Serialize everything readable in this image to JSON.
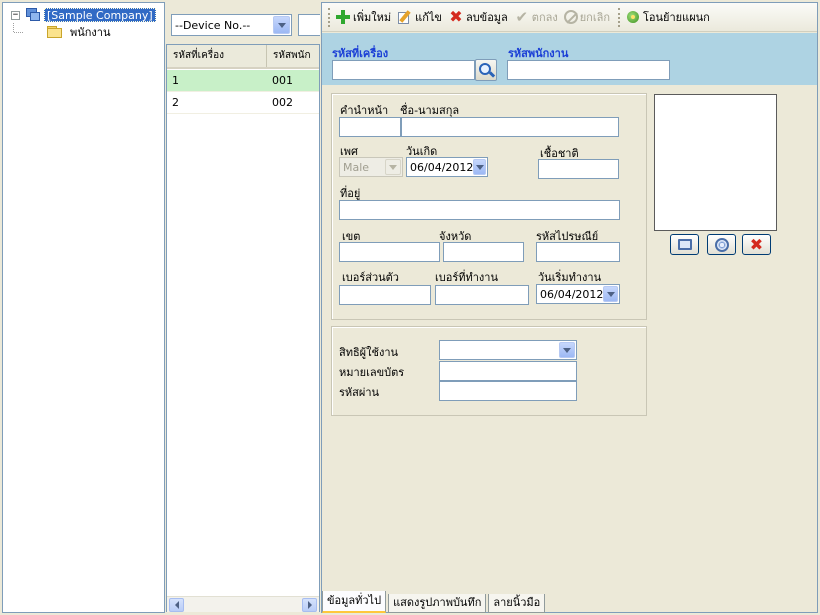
{
  "tree": {
    "root_label": "[Sample Company]",
    "child_label": "พนักงาน",
    "root_expander": "−"
  },
  "device_filter": {
    "value": "--Device No.--"
  },
  "grid": {
    "columns": [
      "รหัสที่เครื่อง",
      "รหัสพนัก"
    ],
    "rows": [
      {
        "machine_id": "1",
        "employee_code": "001"
      },
      {
        "machine_id": "2",
        "employee_code": "002"
      }
    ]
  },
  "toolbar": {
    "add": "เพิ่มใหม่",
    "edit": "แก้ไข",
    "delete": "ลบข้อมูล",
    "ok": "ตกลง",
    "cancel": "ยกเลิก",
    "transfer": "โอนย้ายแผนก"
  },
  "id_band": {
    "machine_id_label": "รหัสที่เครื่อง",
    "employee_code_label": "รหัสพนักงาน",
    "machine_id_value": "",
    "employee_code_value": ""
  },
  "personal": {
    "prefix_label": "คำนำหน้า",
    "name_label": "ชื่อ-นามสกุล",
    "gender_label": "เพศ",
    "gender_value": "Male",
    "birthdate_label": "วันเกิด",
    "birthdate_value": "06/04/2012",
    "nationality_label": "เชื้อชาติ",
    "address_label": "ที่อยู่",
    "district_label": "เขต",
    "province_label": "จังหวัด",
    "postal_label": "รหัสไปรษณีย์",
    "personal_phone_label": "เบอร์ส่วนตัว",
    "work_phone_label": "เบอร์ที่ทำงาน",
    "start_date_label": "วันเริ่มทำงาน",
    "start_date_value": "06/04/2012"
  },
  "access": {
    "privilege_label": "สิทธิผู้ใช้งาน",
    "card_label": "หมายเลขบัตร",
    "password_label": "รหัสผ่าน",
    "privilege_value": ""
  },
  "tabs": [
    "ข้อมูลทั่วไป",
    "แสดงรูปภาพบันทึก",
    "ลายนิ้วมือ"
  ],
  "colors": {
    "id_band": "#aed3e3",
    "band_label": "#1b3fd6",
    "selected_row": "#c8f0c8",
    "tree_selection": "#316ac5"
  }
}
